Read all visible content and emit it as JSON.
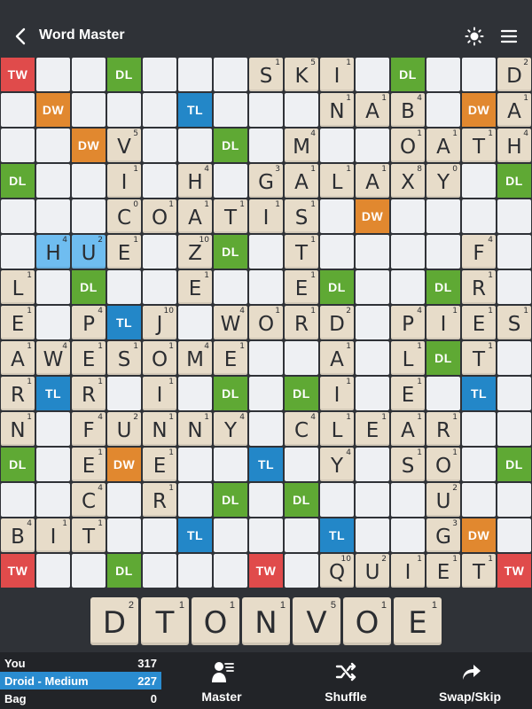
{
  "header": {
    "title": "Word Master"
  },
  "premium_labels": {
    "TW": "TW",
    "DW": "DW",
    "TL": "TL",
    "DL": "DL"
  },
  "board": {
    "size": 15,
    "cells": [
      "TW . . DL . . . . . . . DL . . .",
      ". DW . . . TL . . . . . . . DW .",
      ". . DW . . . DL . . . . . . . .",
      "DL . . . . . . . . . . . . . DL",
      ". . . . . . . . . . DW . . . .",
      ". . . . . . DL . . . . . . . .",
      ". . DL . . . . . . DL . . DL . .",
      ". . . TL . . . . . . . . . . .",
      ". . . . . . . . . . . . DL . .",
      ". TL . . . . DL . DL . . . . TL .",
      ". . . . . . . . . . . . . . .",
      "DL . . DW . . . TL . . . . . . DL",
      ". . . . . . DL . DL . . . . . .",
      ". . . . . TL . . . TL . . . DW .",
      "TW . . DL . . . TW . . . . . . TW"
    ],
    "tiles": [
      {
        "r": 0,
        "c": 7,
        "l": "S",
        "p": "1"
      },
      {
        "r": 0,
        "c": 8,
        "l": "K",
        "p": "5"
      },
      {
        "r": 0,
        "c": 9,
        "l": "I",
        "p": "1"
      },
      {
        "r": 0,
        "c": 14,
        "l": "D",
        "p": "2"
      },
      {
        "r": 1,
        "c": 9,
        "l": "N",
        "p": "1"
      },
      {
        "r": 1,
        "c": 10,
        "l": "A",
        "p": "1"
      },
      {
        "r": 1,
        "c": 11,
        "l": "B",
        "p": "4"
      },
      {
        "r": 1,
        "c": 14,
        "l": "A",
        "p": "1"
      },
      {
        "r": 2,
        "c": 3,
        "l": "V",
        "p": "5"
      },
      {
        "r": 2,
        "c": 8,
        "l": "M",
        "p": "4"
      },
      {
        "r": 2,
        "c": 11,
        "l": "O",
        "p": "1"
      },
      {
        "r": 2,
        "c": 12,
        "l": "A",
        "p": "1"
      },
      {
        "r": 2,
        "c": 13,
        "l": "T",
        "p": "1"
      },
      {
        "r": 2,
        "c": 14,
        "l": "H",
        "p": "4"
      },
      {
        "r": 3,
        "c": 3,
        "l": "I",
        "p": "1"
      },
      {
        "r": 3,
        "c": 5,
        "l": "H",
        "p": "4"
      },
      {
        "r": 3,
        "c": 7,
        "l": "G",
        "p": "3"
      },
      {
        "r": 3,
        "c": 8,
        "l": "A",
        "p": "1"
      },
      {
        "r": 3,
        "c": 9,
        "l": "L",
        "p": "1"
      },
      {
        "r": 3,
        "c": 10,
        "l": "A",
        "p": "1"
      },
      {
        "r": 3,
        "c": 11,
        "l": "X",
        "p": "8"
      },
      {
        "r": 3,
        "c": 12,
        "l": "Y",
        "p": "0"
      },
      {
        "r": 4,
        "c": 3,
        "l": "C",
        "p": "0"
      },
      {
        "r": 4,
        "c": 4,
        "l": "O",
        "p": "1"
      },
      {
        "r": 4,
        "c": 5,
        "l": "A",
        "p": "1"
      },
      {
        "r": 4,
        "c": 6,
        "l": "T",
        "p": "1"
      },
      {
        "r": 4,
        "c": 7,
        "l": "I",
        "p": "1"
      },
      {
        "r": 4,
        "c": 8,
        "l": "S",
        "p": "1"
      },
      {
        "r": 5,
        "c": 1,
        "l": "H",
        "p": "4",
        "recent": true
      },
      {
        "r": 5,
        "c": 2,
        "l": "U",
        "p": "2",
        "recent": true
      },
      {
        "r": 5,
        "c": 3,
        "l": "E",
        "p": "1"
      },
      {
        "r": 5,
        "c": 5,
        "l": "Z",
        "p": "10"
      },
      {
        "r": 5,
        "c": 8,
        "l": "T",
        "p": "1"
      },
      {
        "r": 5,
        "c": 13,
        "l": "F",
        "p": "4"
      },
      {
        "r": 6,
        "c": 0,
        "l": "L",
        "p": "1"
      },
      {
        "r": 6,
        "c": 5,
        "l": "E",
        "p": "1"
      },
      {
        "r": 6,
        "c": 8,
        "l": "E",
        "p": "1"
      },
      {
        "r": 6,
        "c": 13,
        "l": "R",
        "p": "1"
      },
      {
        "r": 7,
        "c": 0,
        "l": "E",
        "p": "1"
      },
      {
        "r": 7,
        "c": 2,
        "l": "P",
        "p": "4"
      },
      {
        "r": 7,
        "c": 4,
        "l": "J",
        "p": "10"
      },
      {
        "r": 7,
        "c": 6,
        "l": "W",
        "p": "4"
      },
      {
        "r": 7,
        "c": 7,
        "l": "O",
        "p": "1"
      },
      {
        "r": 7,
        "c": 8,
        "l": "R",
        "p": "1"
      },
      {
        "r": 7,
        "c": 9,
        "l": "D",
        "p": "2"
      },
      {
        "r": 7,
        "c": 11,
        "l": "P",
        "p": "4"
      },
      {
        "r": 7,
        "c": 12,
        "l": "I",
        "p": "1"
      },
      {
        "r": 7,
        "c": 13,
        "l": "E",
        "p": "1"
      },
      {
        "r": 7,
        "c": 14,
        "l": "S",
        "p": "1"
      },
      {
        "r": 8,
        "c": 0,
        "l": "A",
        "p": "1"
      },
      {
        "r": 8,
        "c": 1,
        "l": "W",
        "p": "4"
      },
      {
        "r": 8,
        "c": 2,
        "l": "E",
        "p": "1"
      },
      {
        "r": 8,
        "c": 3,
        "l": "S",
        "p": "1"
      },
      {
        "r": 8,
        "c": 4,
        "l": "O",
        "p": "1"
      },
      {
        "r": 8,
        "c": 5,
        "l": "M",
        "p": "4"
      },
      {
        "r": 8,
        "c": 6,
        "l": "E",
        "p": "1"
      },
      {
        "r": 8,
        "c": 9,
        "l": "A",
        "p": "1"
      },
      {
        "r": 8,
        "c": 11,
        "l": "L",
        "p": "1"
      },
      {
        "r": 8,
        "c": 13,
        "l": "T",
        "p": "1"
      },
      {
        "r": 9,
        "c": 0,
        "l": "R",
        "p": "1"
      },
      {
        "r": 9,
        "c": 2,
        "l": "R",
        "p": "1"
      },
      {
        "r": 9,
        "c": 4,
        "l": "I",
        "p": "1"
      },
      {
        "r": 9,
        "c": 9,
        "l": "I",
        "p": "1"
      },
      {
        "r": 9,
        "c": 11,
        "l": "E",
        "p": "1"
      },
      {
        "r": 10,
        "c": 0,
        "l": "N",
        "p": "1"
      },
      {
        "r": 10,
        "c": 2,
        "l": "F",
        "p": "4"
      },
      {
        "r": 10,
        "c": 3,
        "l": "U",
        "p": "2"
      },
      {
        "r": 10,
        "c": 4,
        "l": "N",
        "p": "1"
      },
      {
        "r": 10,
        "c": 5,
        "l": "N",
        "p": "1"
      },
      {
        "r": 10,
        "c": 6,
        "l": "Y",
        "p": "4"
      },
      {
        "r": 10,
        "c": 8,
        "l": "C",
        "p": "4"
      },
      {
        "r": 10,
        "c": 9,
        "l": "L",
        "p": "1"
      },
      {
        "r": 10,
        "c": 10,
        "l": "E",
        "p": "1"
      },
      {
        "r": 10,
        "c": 11,
        "l": "A",
        "p": "1"
      },
      {
        "r": 10,
        "c": 12,
        "l": "R",
        "p": "1"
      },
      {
        "r": 11,
        "c": 2,
        "l": "E",
        "p": "1"
      },
      {
        "r": 11,
        "c": 4,
        "l": "E",
        "p": "1"
      },
      {
        "r": 11,
        "c": 9,
        "l": "Y",
        "p": "4"
      },
      {
        "r": 11,
        "c": 11,
        "l": "S",
        "p": "1"
      },
      {
        "r": 11,
        "c": 12,
        "l": "O",
        "p": "1"
      },
      {
        "r": 12,
        "c": 2,
        "l": "C",
        "p": "4"
      },
      {
        "r": 12,
        "c": 4,
        "l": "R",
        "p": "1"
      },
      {
        "r": 12,
        "c": 12,
        "l": "U",
        "p": "2"
      },
      {
        "r": 13,
        "c": 0,
        "l": "B",
        "p": "4"
      },
      {
        "r": 13,
        "c": 1,
        "l": "I",
        "p": "1"
      },
      {
        "r": 13,
        "c": 2,
        "l": "T",
        "p": "1"
      },
      {
        "r": 13,
        "c": 12,
        "l": "G",
        "p": "3"
      },
      {
        "r": 14,
        "c": 9,
        "l": "Q",
        "p": "10"
      },
      {
        "r": 14,
        "c": 10,
        "l": "U",
        "p": "2"
      },
      {
        "r": 14,
        "c": 11,
        "l": "I",
        "p": "1"
      },
      {
        "r": 14,
        "c": 12,
        "l": "E",
        "p": "1"
      },
      {
        "r": 14,
        "c": 13,
        "l": "T",
        "p": "1"
      }
    ]
  },
  "rack": [
    {
      "l": "D",
      "p": "2"
    },
    {
      "l": "T",
      "p": "1"
    },
    {
      "l": "O",
      "p": "1"
    },
    {
      "l": "N",
      "p": "1"
    },
    {
      "l": "V",
      "p": "5"
    },
    {
      "l": "O",
      "p": "1"
    },
    {
      "l": "E",
      "p": "1"
    }
  ],
  "scores": {
    "you_label": "You",
    "you_score": "317",
    "droid_label": "Droid - Medium",
    "droid_score": "227",
    "bag_label": "Bag",
    "bag_count": "0"
  },
  "actions": {
    "master": "Master",
    "shuffle": "Shuffle",
    "swap": "Swap/Skip"
  },
  "colors": {
    "TW": "#e04b4b",
    "DW": "#e1882f",
    "TL": "#2387c8",
    "DL": "#5fa934",
    "tile": "#e7dcc9",
    "recent_tile": "#6fbdf0",
    "active_player": "#2a8cd0"
  },
  "icons": {
    "back": "chevron-left-icon",
    "theme": "sun-icon",
    "menu": "hamburger-icon",
    "master": "master-icon",
    "shuffle": "shuffle-icon",
    "swap": "swap-icon"
  }
}
